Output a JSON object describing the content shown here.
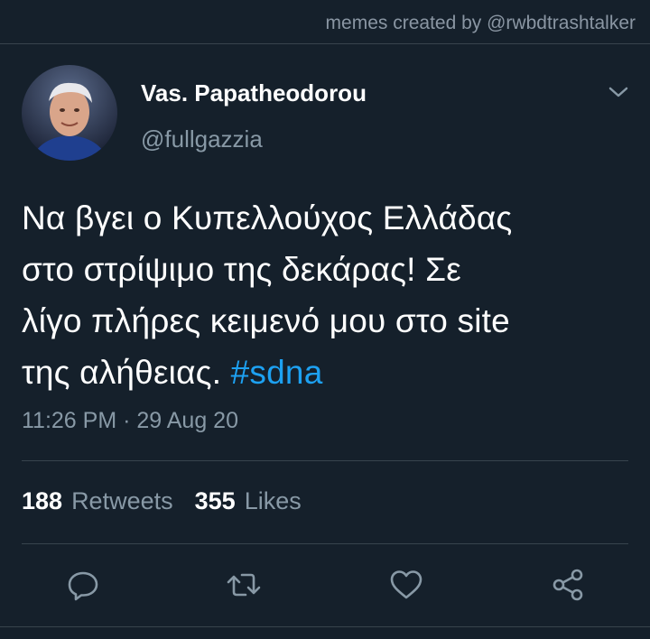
{
  "watermark": "memes created by @rwbdtrashtalker",
  "tweet": {
    "author_name": "Vas. Papatheodorou",
    "author_handle": "@fullgazzia",
    "text_lines": [
      "Να βγει ο Κυπελλούχος Ελλάδας",
      "στο στρίψιμο της δεκάρας! Σε",
      "λίγο πλήρες κειμενό μου στο site",
      "της αλήθειας. "
    ],
    "hashtag": "#sdna",
    "timestamp": "11:26 PM · 29 Aug 20",
    "retweets_count": "188",
    "retweets_label": "Retweets",
    "likes_count": "355",
    "likes_label": "Likes"
  },
  "icons": {
    "menu": "chevron-down-icon",
    "reply": "reply-icon",
    "retweet": "retweet-icon",
    "like": "heart-icon",
    "share": "share-icon"
  },
  "colors": {
    "background": "#15202b",
    "accent": "#1da1f2",
    "secondary_text": "#8899a6",
    "divider": "#38444d"
  }
}
